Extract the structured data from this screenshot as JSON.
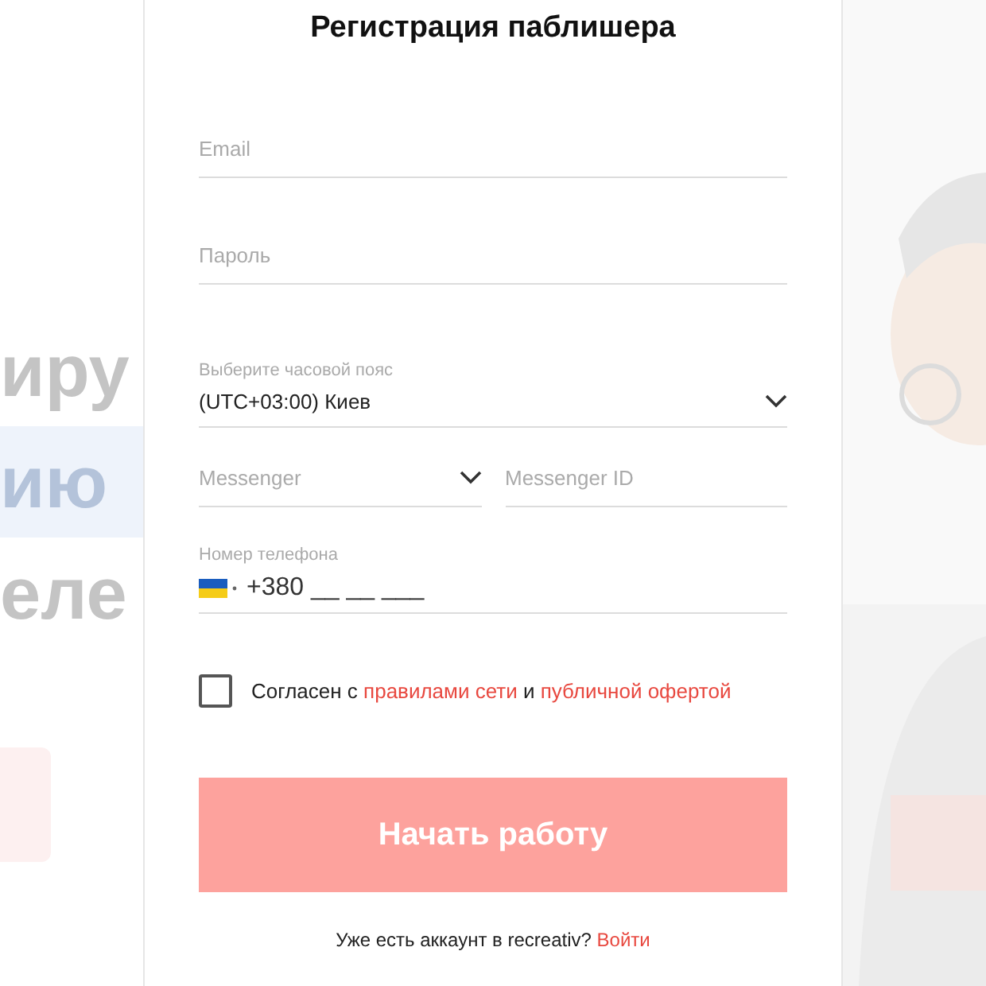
{
  "background": {
    "lines": [
      {
        "text": "иру",
        "highlighted": false
      },
      {
        "text": "ию",
        "highlighted": true
      },
      {
        "text": "еле",
        "highlighted": false
      }
    ]
  },
  "modal": {
    "title": "Регистрация паблишера",
    "fields": [
      {
        "kind": "text",
        "placeholder": "Email"
      },
      {
        "kind": "password",
        "placeholder": "Пароль"
      },
      {
        "kind": "select",
        "label": "Выберите часовой пояс",
        "value": "(UTC+03:00) Киев"
      }
    ],
    "messenger": {
      "select_placeholder": "Messenger",
      "id_placeholder": "Messenger ID"
    },
    "phone": {
      "label": "Номер телефона",
      "value": "+380 __ __ ___"
    },
    "agreement": {
      "checked": false,
      "text": "Согласен с",
      "link_1": "правилами сети",
      "joiner": "и",
      "link_2": "публичной офертой"
    },
    "submit": {
      "label": "Начать работу",
      "disabled": true
    },
    "footer": {
      "text": "Уже есть аккаунт в recreativ?",
      "link": "Войти"
    }
  }
}
